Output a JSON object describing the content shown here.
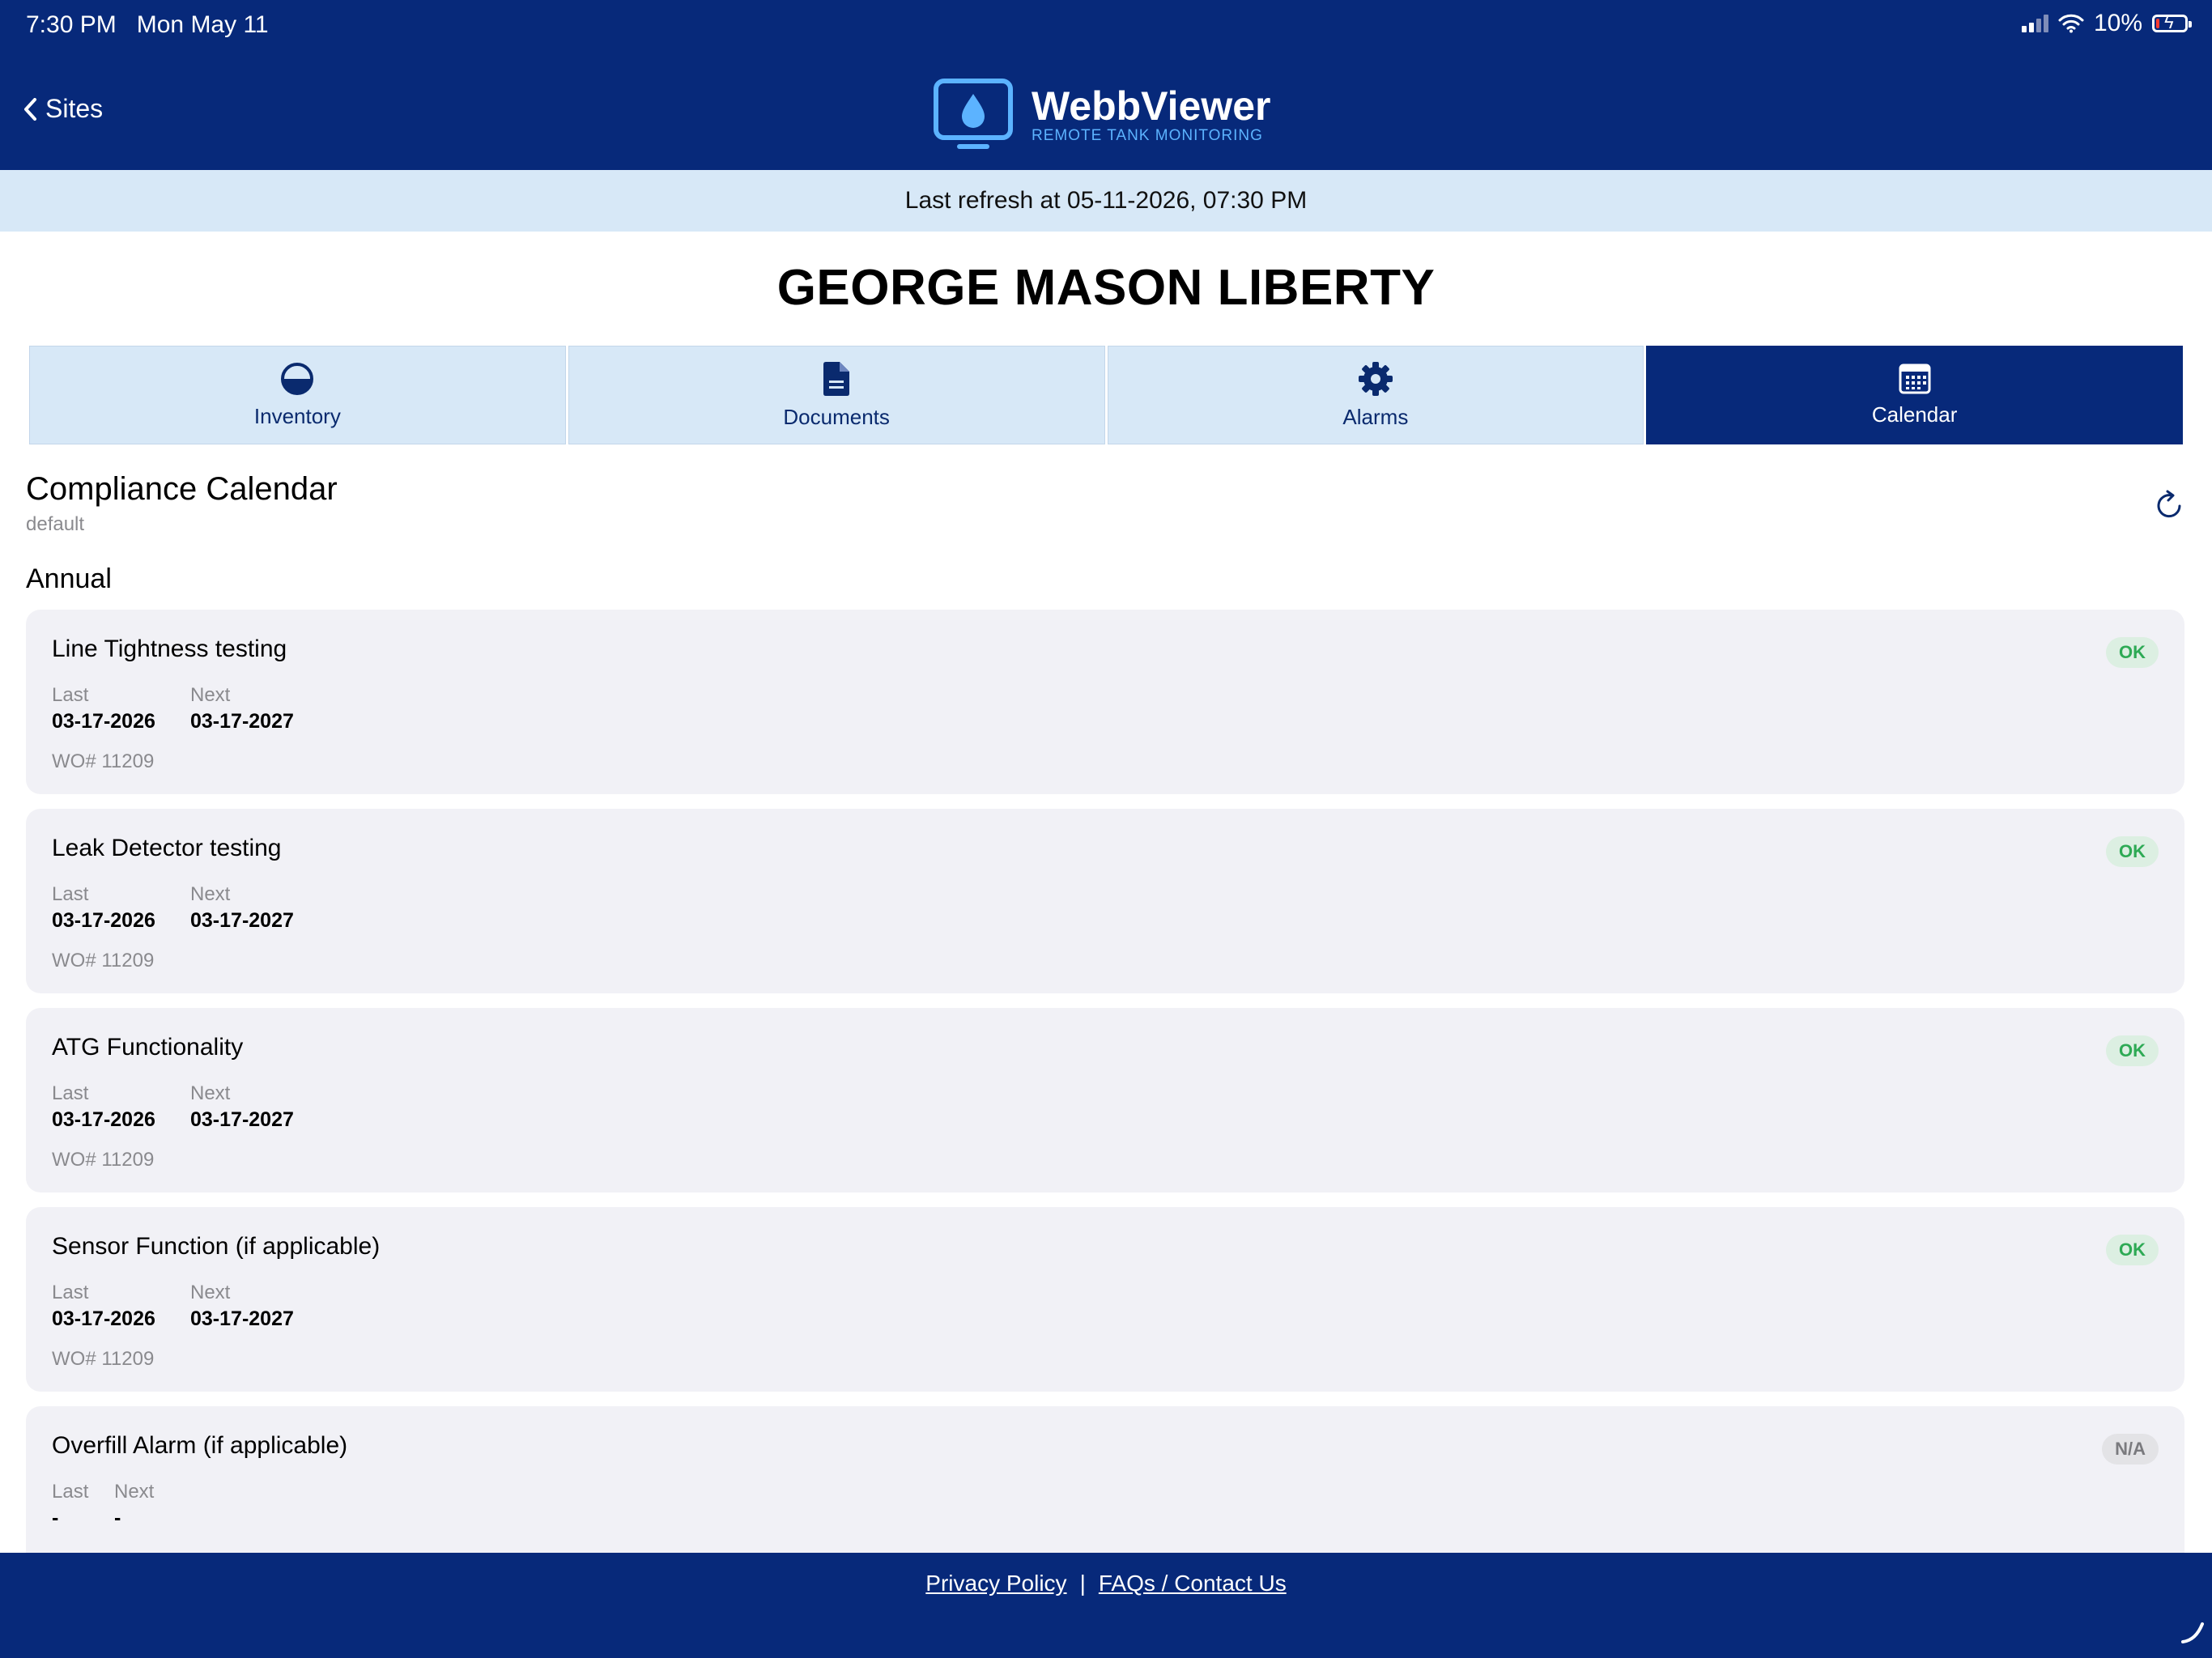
{
  "status_bar": {
    "time": "7:30 PM",
    "date": "Mon May 11",
    "battery": "10%"
  },
  "header": {
    "back_label": "Sites",
    "logo_title": "WebbViewer",
    "logo_subtitle": "REMOTE TANK MONITORING"
  },
  "refresh_text": "Last refresh at 05-11-2026, 07:30 PM",
  "site_title": "GEORGE MASON LIBERTY",
  "tabs": [
    {
      "label": "Inventory",
      "icon": "half-circle-icon"
    },
    {
      "label": "Documents",
      "icon": "document-icon"
    },
    {
      "label": "Alarms",
      "icon": "gear-icon"
    },
    {
      "label": "Calendar",
      "icon": "calendar-icon",
      "active": true
    }
  ],
  "calendar": {
    "title": "Compliance Calendar",
    "subtitle": "default",
    "group": "Annual",
    "last_label": "Last",
    "next_label": "Next",
    "items": [
      {
        "title": "Line Tightness testing",
        "status": "OK",
        "last": "03-17-2026",
        "next": "03-17-2027",
        "wo": "WO# 11209"
      },
      {
        "title": "Leak Detector testing",
        "status": "OK",
        "last": "03-17-2026",
        "next": "03-17-2027",
        "wo": "WO# 11209"
      },
      {
        "title": "ATG Functionality",
        "status": "OK",
        "last": "03-17-2026",
        "next": "03-17-2027",
        "wo": "WO# 11209"
      },
      {
        "title": "Sensor Function (if applicable)",
        "status": "OK",
        "last": "03-17-2026",
        "next": "03-17-2027",
        "wo": "WO# 11209"
      },
      {
        "title": "Overfill Alarm (if applicable)",
        "status": "N/A",
        "last": "-",
        "next": "-",
        "wo": ""
      }
    ]
  },
  "footer": {
    "privacy": "Privacy Policy",
    "separator": "|",
    "faq": "FAQs / Contact Us"
  },
  "colors": {
    "brand": "#07297a",
    "light_blue": "#d7e8f7",
    "ok_green": "#2eaa55"
  }
}
